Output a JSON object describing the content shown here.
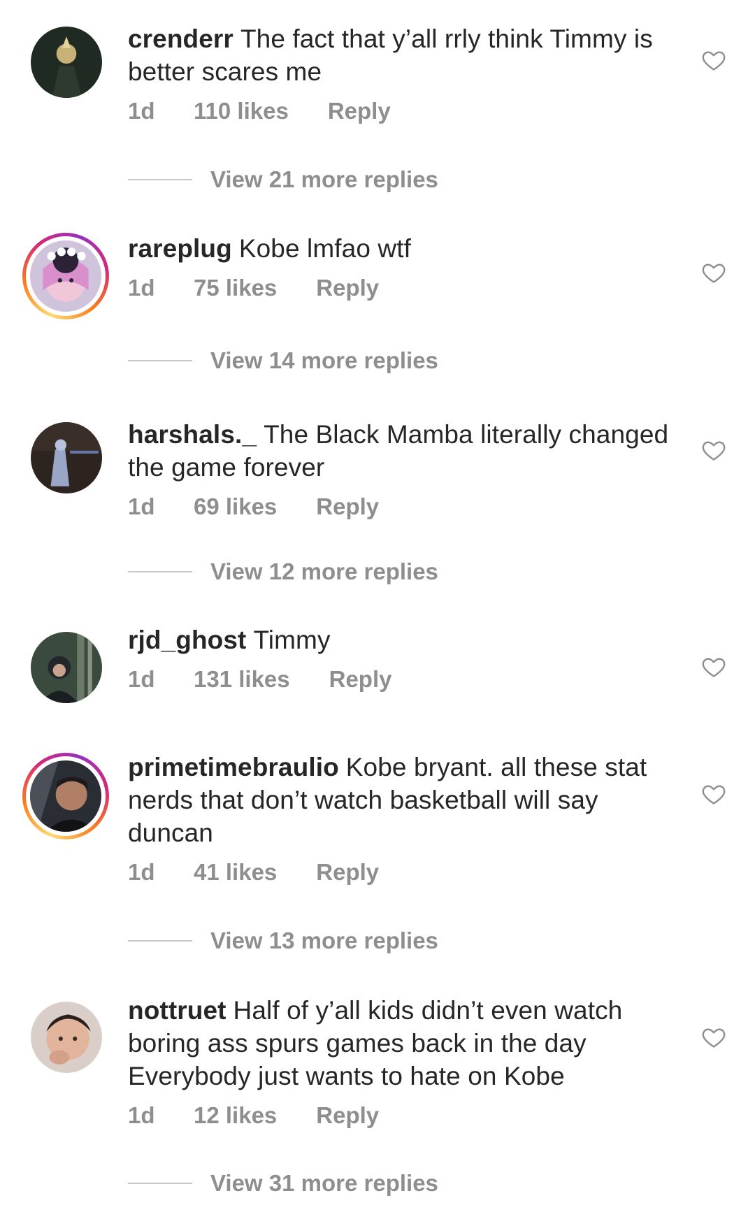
{
  "comments": [
    {
      "username": "crenderr",
      "text": "The fact that y’all rrly think Timmy is better scares me",
      "age": "1d",
      "likes": "110 likes",
      "reply": "Reply",
      "view_replies": "View 21 more replies"
    },
    {
      "username": "rareplug",
      "text": "Kobe lmfao wtf",
      "age": "1d",
      "likes": "75 likes",
      "reply": "Reply",
      "view_replies": "View 14 more replies"
    },
    {
      "username": "harshals._",
      "text": "The Black Mamba literally changed the game forever",
      "age": "1d",
      "likes": "69 likes",
      "reply": "Reply",
      "view_replies": "View 12 more replies"
    },
    {
      "username": "rjd_ghost",
      "text": "Timmy",
      "age": "1d",
      "likes": "131 likes",
      "reply": "Reply"
    },
    {
      "username": "primetimebraulio",
      "text": "Kobe bryant. all these stat nerds that don’t watch basketball will say duncan",
      "age": "1d",
      "likes": "41 likes",
      "reply": "Reply",
      "view_replies": "View 13 more replies"
    },
    {
      "username": "nottruet",
      "text": "Half of y’all kids didn’t even watch boring ass spurs games back in the day Everybody just wants to hate on Kobe",
      "age": "1d",
      "likes": "12 likes",
      "reply": "Reply",
      "view_replies": "View 31 more replies"
    }
  ],
  "icons": {
    "like": "heart-outline-icon"
  },
  "colors": {
    "text": "#262626",
    "secondary": "#8e8e8e",
    "divider": "#c7c7c7"
  }
}
